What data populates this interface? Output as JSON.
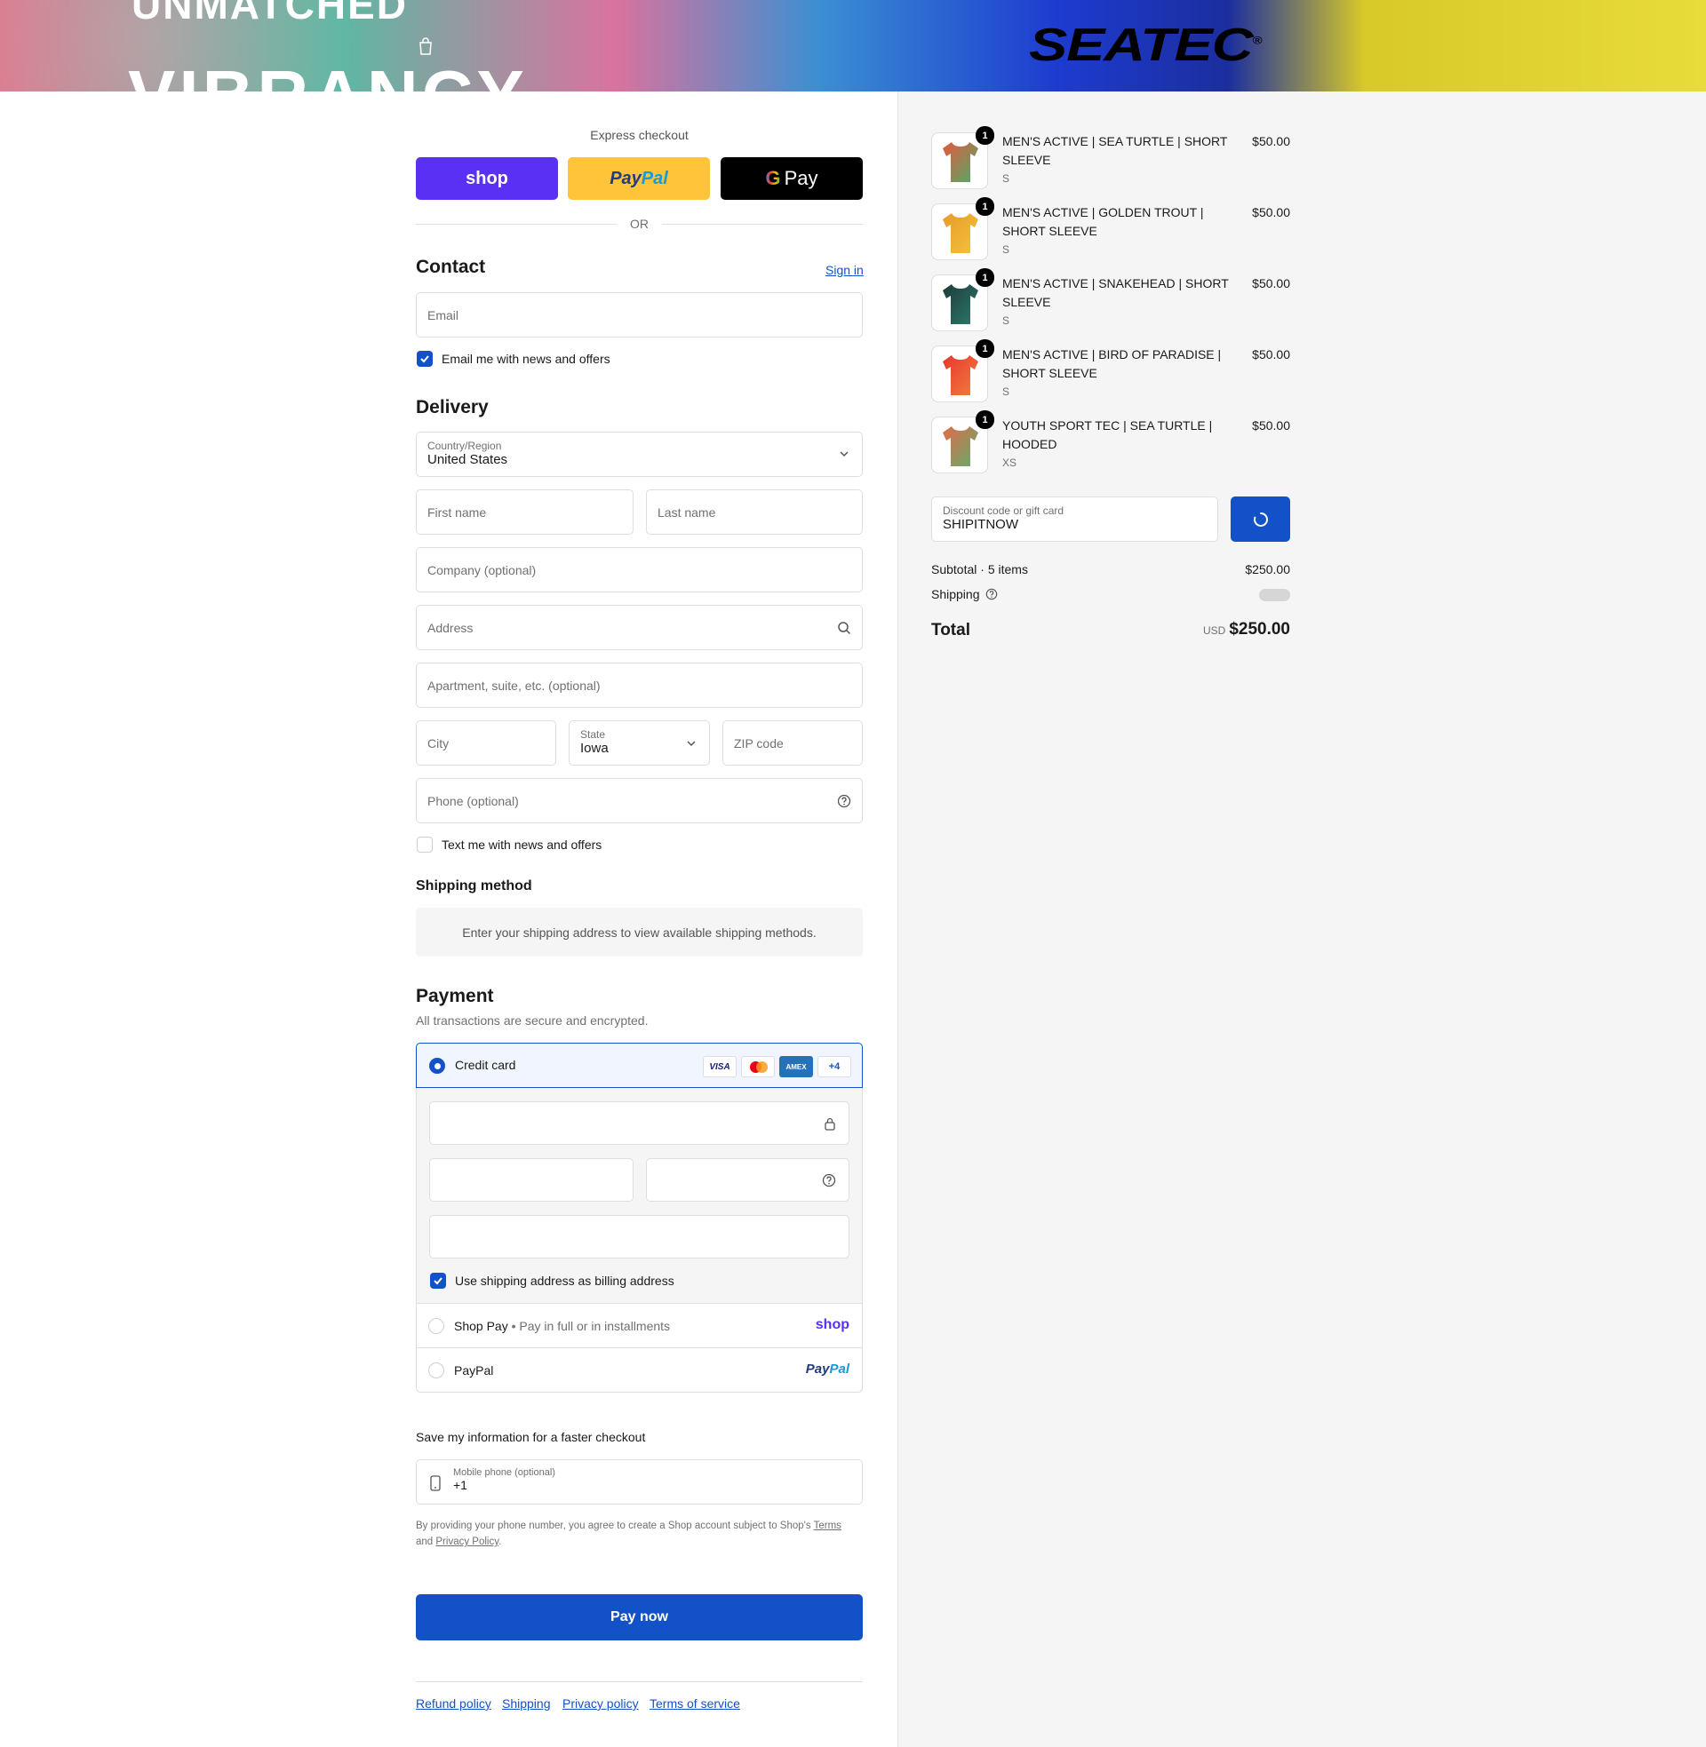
{
  "hero": {
    "line1": "UNMATCHED",
    "line2": "VIBRANCY",
    "brand": "SEATEC",
    "brand_mark": "®"
  },
  "express": {
    "title": "Express checkout",
    "shop_label": "shop",
    "paypal_label_a": "Pay",
    "paypal_label_b": "Pal",
    "gpay_label": "Pay",
    "divider": "OR"
  },
  "contact": {
    "title": "Contact",
    "sign_in": "Sign in",
    "email_placeholder": "Email",
    "news_checkbox": "Email me with news and offers"
  },
  "delivery": {
    "title": "Delivery",
    "country_label": "Country/Region",
    "country_value": "United States",
    "first_name": "First name",
    "last_name": "Last name",
    "company": "Company (optional)",
    "address": "Address",
    "apartment": "Apartment, suite, etc. (optional)",
    "city": "City",
    "state_label": "State",
    "state_value": "Iowa",
    "zip": "ZIP code",
    "phone": "Phone (optional)",
    "text_checkbox": "Text me with news and offers"
  },
  "shipping_method": {
    "title": "Shipping method",
    "notice": "Enter your shipping address to view available shipping methods."
  },
  "payment": {
    "title": "Payment",
    "subtitle": "All transactions are secure and encrypted.",
    "credit_card": "Credit card",
    "card_brands": [
      "VISA",
      "",
      "AMEX",
      "+4"
    ],
    "billing_checkbox": "Use shipping address as billing address",
    "shop_pay": "Shop Pay",
    "shop_pay_sub": "Pay in full or in installments",
    "shop_logo": "shop",
    "paypal": "PayPal",
    "paypal_logo_a": "Pay",
    "paypal_logo_b": "Pal"
  },
  "save_info": {
    "title": "Save my information for a faster checkout",
    "mobile_label": "Mobile phone (optional)",
    "mobile_value": "+1",
    "disclaimer_a": "By providing your phone number, you agree to create a Shop account subject to Shop's",
    "terms": "Terms",
    "and": "and",
    "privacy": "Privacy Policy",
    "period": "."
  },
  "pay_now": "Pay now",
  "footer_links": [
    "Refund policy",
    "Shipping",
    "Privacy policy",
    "Terms of service"
  ],
  "cart": {
    "items": [
      {
        "qty": "1",
        "name_1": "MEN'S ACTIVE | SEA TURTLE | SHORT",
        "name_2": "SLEEVE",
        "variant": "S",
        "price": "$50.00",
        "color_a": "#e6573d",
        "color_b": "#4cae6a"
      },
      {
        "qty": "1",
        "name_1": "MEN'S ACTIVE | GOLDEN TROUT |",
        "name_2": "SHORT SLEEVE",
        "variant": "S",
        "price": "$50.00",
        "color_a": "#e89a2a",
        "color_b": "#f2c43b"
      },
      {
        "qty": "1",
        "name_1": "MEN'S ACTIVE | SNAKEHEAD | SHORT",
        "name_2": "SLEEVE",
        "variant": "S",
        "price": "$50.00",
        "color_a": "#1f3b3a",
        "color_b": "#2a7a6a"
      },
      {
        "qty": "1",
        "name_1": "MEN'S ACTIVE | BIRD OF PARADISE |",
        "name_2": "SHORT SLEEVE",
        "variant": "S",
        "price": "$50.00",
        "color_a": "#e8362f",
        "color_b": "#f07f3c"
      },
      {
        "qty": "1",
        "name_1": "YOUTH SPORT TEC | SEA TURTLE |",
        "name_2": "HOODED",
        "variant": "XS",
        "price": "$50.00",
        "color_a": "#e36a4a",
        "color_b": "#5fae6b"
      }
    ],
    "discount_label": "Discount code or gift card",
    "discount_value": "SHIPITNOW",
    "subtotal_label": "Subtotal · 5 items",
    "subtotal_value": "$250.00",
    "shipping_label": "Shipping",
    "total_label": "Total",
    "currency": "USD",
    "total_value": "$250.00"
  },
  "colors": {
    "accent": "#1351c8",
    "shop": "#5a31f4",
    "paypal": "#ffc439"
  }
}
